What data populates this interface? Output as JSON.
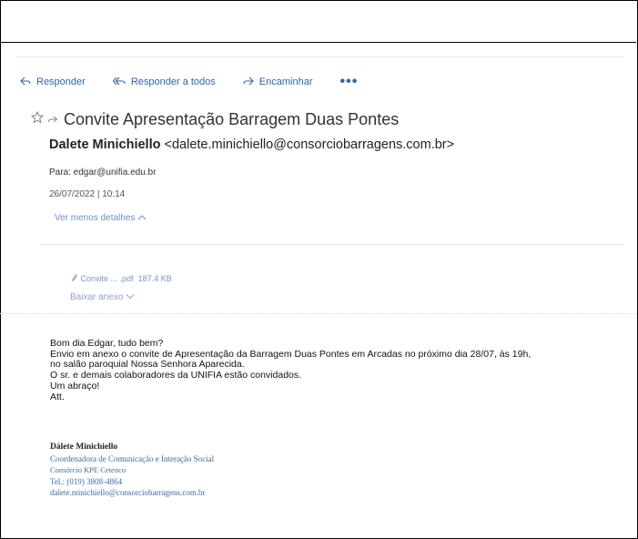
{
  "toolbar": {
    "reply_label": "Responder",
    "reply_all_label": "Responder a todos",
    "forward_label": "Encaminhar",
    "more_label": "•••"
  },
  "message": {
    "subject": "Convite Apresentação Barragem Duas Pontes",
    "sender_name": "Dalete Minichiello",
    "sender_email": "<dalete.minichiello@consorciobarragens.com.br>",
    "to": "Para: edgar@unifia.edu.br",
    "date": "26/07/2022 | 10:14",
    "details_toggle": "Ver menos detalhes"
  },
  "attachment": {
    "name": "Convite ... .pdf",
    "size": "187.4 KB",
    "download_label": "Baixar anexo"
  },
  "body": {
    "lines": [
      "Bom dia Edgar, tudo bem?",
      "Envio em anexo o convite de Apresentação da Barragem Duas Pontes em Arcadas no próximo dia 28/07, às 19h,",
      "no salão paroquial Nossa Senhora Aparecida.",
      "O sr. e demais colaboradores da UNIFIA estão convidados.",
      "Um abraço!",
      "Att."
    ]
  },
  "signature": {
    "name": "Dálete Minichiello",
    "title": "Coordenadora de Comunicação e Interação Social",
    "org": "Consórcio KPE Cetenco",
    "phone": "Tel.: (019) 3808-4864",
    "email": "dalete.minichiello@consorciobarragens.com.br"
  },
  "colors": {
    "accent": "#2f64a8",
    "link_light": "#6b8fc3"
  },
  "icons": [
    "reply-icon",
    "reply-all-icon",
    "forward-icon",
    "star-icon",
    "forwarded-arrow-icon",
    "paperclip-icon",
    "chevron-up-icon",
    "chevron-down-icon"
  ]
}
